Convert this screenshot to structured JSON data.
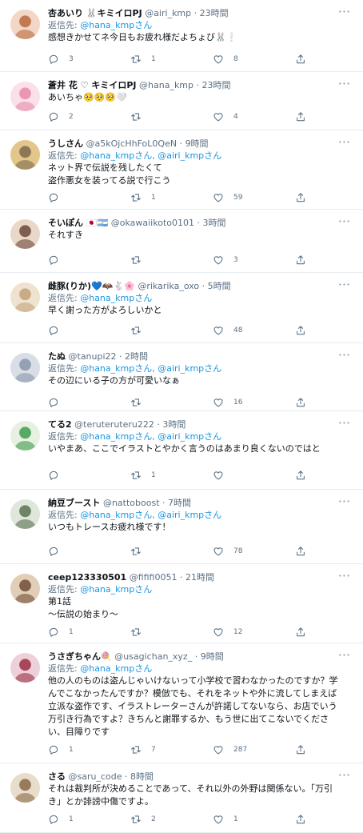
{
  "reply_label": "返信先:",
  "tweets": [
    {
      "name": "杏あいり 🐰キミイロPJ",
      "handle": "@airi_kmp",
      "time": "23時間",
      "reply_to": [
        "@hana_kmpさん"
      ],
      "text": "感想きかせてネ今日もお疲れ様だよちょび🐰❕",
      "replies": "3",
      "retweets": "1",
      "likes": "8",
      "avatar_colors": [
        "#f3d6c6",
        "#b86a3e"
      ]
    },
    {
      "name": "蒼井 花 ♡ キミイロPJ",
      "handle": "@hana_kmp",
      "time": "23時間",
      "reply_to": [],
      "text": "あいちゃ🥺🥺🥺🤍",
      "replies": "2",
      "retweets": "",
      "likes": "4",
      "avatar_colors": [
        "#fbe0ea",
        "#e88aa8"
      ]
    },
    {
      "name": "うしさん",
      "handle": "@a5kOjcHhFoL0QeN",
      "time": "9時間",
      "reply_to": [
        "@hana_kmpさん,",
        "@airi_kmpさん"
      ],
      "text": "ネット界で伝説を残したくて\n盗作悪女を装ってる説で行こう",
      "replies": "",
      "retweets": "1",
      "likes": "59",
      "avatar_colors": [
        "#e3c78a",
        "#7c6a4e"
      ]
    },
    {
      "name": "そいぽん 🇯🇵🇦🇷",
      "handle": "@okawaiikoto0101",
      "time": "3時間",
      "reply_to": [],
      "text": "それすき",
      "replies": "",
      "retweets": "",
      "likes": "3",
      "avatar_colors": [
        "#e9d7c8",
        "#6b4a3a"
      ]
    },
    {
      "name": "雌豚(りか)💙🦇🐇🌸",
      "handle": "@rikarika_oxo",
      "time": "5時間",
      "reply_to": [
        "@hana_kmpさん"
      ],
      "text": "早く謝った方がよろしいかと",
      "replies": "",
      "retweets": "",
      "likes": "48",
      "avatar_colors": [
        "#efe3cf",
        "#c2a27a"
      ]
    },
    {
      "name": "たぬ",
      "handle": "@tanupi22",
      "time": "2時間",
      "reply_to": [
        "@hana_kmpさん,",
        "@airi_kmpさん"
      ],
      "text": "その辺にいる子の方が可愛いなぁ",
      "replies": "",
      "retweets": "",
      "likes": "16",
      "avatar_colors": [
        "#d8dde6",
        "#8a96a8"
      ]
    },
    {
      "name": "てる2",
      "handle": "@teruteruteru222",
      "time": "3時間",
      "reply_to": [
        "@hana_kmpさん,",
        "@airi_kmpさん"
      ],
      "text": "いやまあ、ここでイラストとやかく言うのはあまり良くないのではと",
      "replies": "",
      "retweets": "1",
      "likes": "",
      "avatar_colors": [
        "#e7f1e2",
        "#3f9b4e"
      ]
    },
    {
      "name": "納豆ブースト",
      "handle": "@nattoboost",
      "time": "7時間",
      "reply_to": [
        "@hana_kmpさん,",
        "@airi_kmpさん"
      ],
      "text": "いつもトレースお疲れ様です！",
      "replies": "",
      "retweets": "",
      "likes": "78",
      "avatar_colors": [
        "#dfe6da",
        "#5a7152"
      ]
    },
    {
      "name": "ceep123330501",
      "handle": "@fififi0051",
      "time": "21時間",
      "reply_to": [
        "@hana_kmpさん"
      ],
      "text": "第1話\n〜伝説の始まり〜",
      "replies": "1",
      "retweets": "",
      "likes": "12",
      "avatar_colors": [
        "#e2cdb6",
        "#6f4e38"
      ]
    },
    {
      "name": "うさぎちゃん🍭",
      "handle": "@usagichan_xyz_",
      "time": "9時間",
      "reply_to": [
        "@hana_kmpさん"
      ],
      "text": "他の人のものは盗んじゃいけないって小学校で習わなかったのですか？学んでこなかったんですか？模倣でも、それをネットや外に流してしまえば立派な盗作です、イラストレーターさんが許諾してないなら、お店でいう万引き行為ですよ？きちんと謝罪するか、もう世に出てこないでください、目障りです",
      "replies": "1",
      "retweets": "7",
      "likes": "287",
      "avatar_colors": [
        "#eed1d8",
        "#9a2f48"
      ]
    },
    {
      "name": "さる",
      "handle": "@saru_code",
      "time": "8時間",
      "reply_to": [],
      "text": "それは裁判所が決めることであって、それ以外の外野は関係ない。「万引き」とか誹謗中傷ですよ。",
      "replies": "1",
      "retweets": "2",
      "likes": "1",
      "avatar_colors": [
        "#e8dccb",
        "#8a6a48"
      ]
    }
  ]
}
